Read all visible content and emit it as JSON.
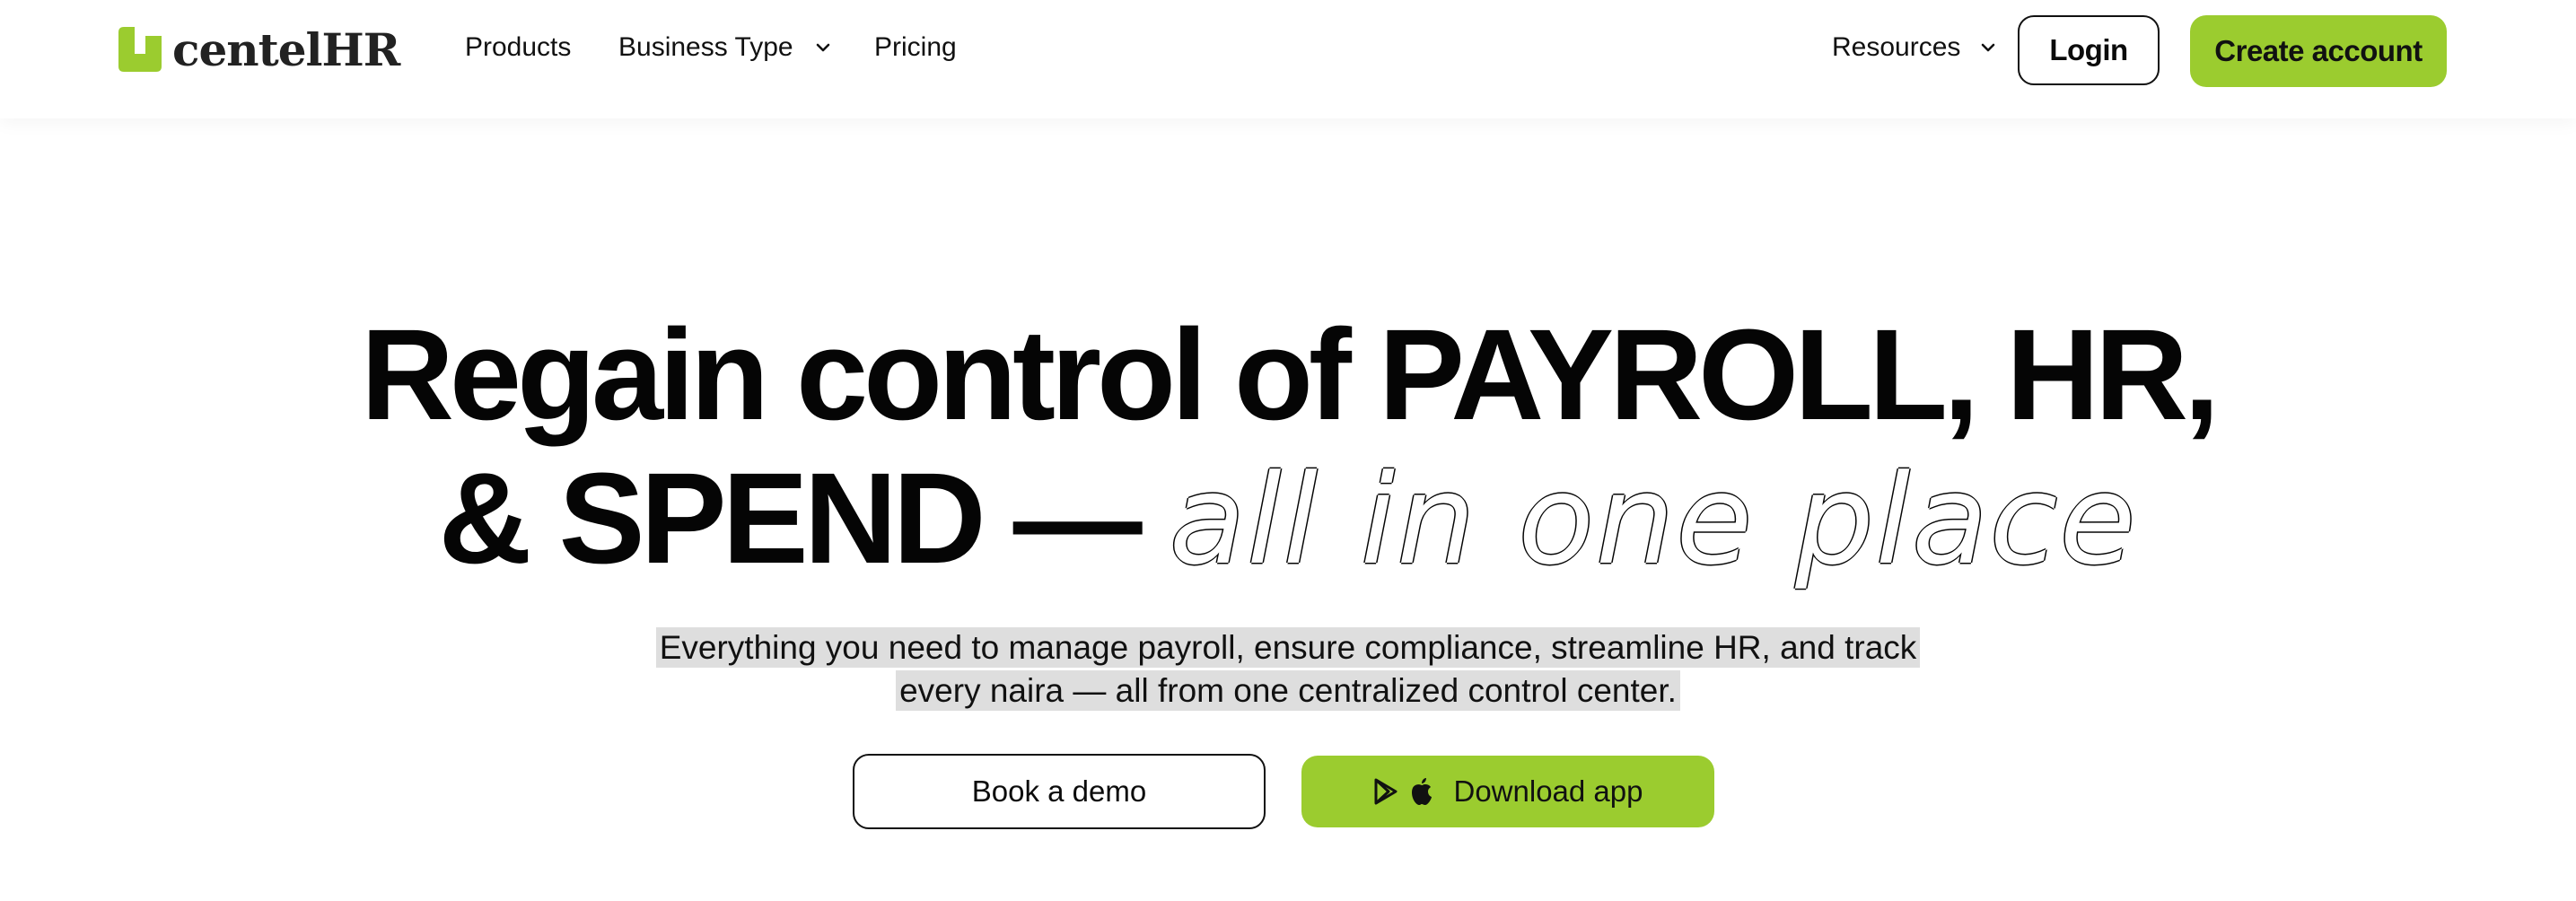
{
  "brand": {
    "name": "centelHR",
    "accent_color": "#9bcc2f",
    "logo_icon": "centelhr-logo-icon"
  },
  "nav": {
    "products": "Products",
    "business_type": "Business Type",
    "pricing": "Pricing",
    "resources": "Resources",
    "login": "Login",
    "create_account": "Create account"
  },
  "hero": {
    "title_line1": "Regain control of PAYROLL, HR,",
    "title_line2_bold": "& SPEND —",
    "title_line2_light": "all in one place",
    "subtitle_line1": "Everything you need to manage payroll, ensure compliance, streamline HR, and track",
    "subtitle_line2": "every naira — all from one centralized control center.",
    "book_demo": "Book a demo",
    "download_app": "Download app",
    "store_icons": [
      "google-play-icon",
      "apple-icon"
    ]
  }
}
